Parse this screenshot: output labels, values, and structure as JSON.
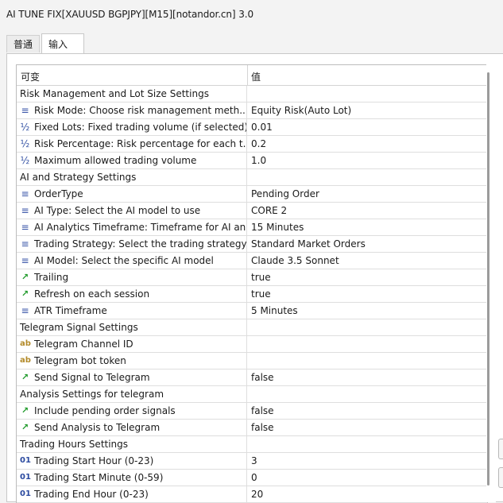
{
  "window": {
    "title": "AI TUNE FIX[XAUUSD BGPJPY][M15][notandor.cn] 3.0"
  },
  "tabs": [
    {
      "label": "普通",
      "active": false
    },
    {
      "label": "输入",
      "active": true
    }
  ],
  "grid": {
    "headers": {
      "variable": "可变",
      "value": "值"
    },
    "rows": [
      {
        "type": "group",
        "name": "Risk Management and Lot Size Settings",
        "value": ""
      },
      {
        "type": "enum",
        "icon": "≡",
        "name": "Risk Mode: Choose risk management meth...",
        "value": "Equity Risk(Auto Lot)"
      },
      {
        "type": "dbl",
        "icon": "½",
        "name": "Fixed Lots: Fixed trading volume (if selected)",
        "value": "0.01"
      },
      {
        "type": "dbl",
        "icon": "½",
        "name": "Risk Percentage: Risk percentage for each t...",
        "value": "0.2"
      },
      {
        "type": "dbl",
        "icon": "½",
        "name": "Maximum allowed trading volume",
        "value": "1.0"
      },
      {
        "type": "group",
        "name": "AI and Strategy Settings",
        "value": ""
      },
      {
        "type": "enum",
        "icon": "≡",
        "name": "OrderType",
        "value": "Pending Order"
      },
      {
        "type": "enum",
        "icon": "≡",
        "name": "AI Type: Select the AI model to use",
        "value": "CORE 2"
      },
      {
        "type": "enum",
        "icon": "≡",
        "name": "AI Analytics Timeframe: Timeframe for AI an...",
        "value": "15 Minutes"
      },
      {
        "type": "enum",
        "icon": "≡",
        "name": "Trading Strategy: Select the trading strategy...",
        "value": "Standard Market Orders"
      },
      {
        "type": "enum",
        "icon": "≡",
        "name": "AI Model: Select the specific AI model",
        "value": "Claude 3.5 Sonnet"
      },
      {
        "type": "bool",
        "icon": "↗",
        "name": "Trailing",
        "value": "true"
      },
      {
        "type": "bool",
        "icon": "↗",
        "name": "Refresh on each session",
        "value": "true"
      },
      {
        "type": "enum",
        "icon": "≡",
        "name": "ATR Timeframe",
        "value": "5 Minutes"
      },
      {
        "type": "group",
        "name": "Telegram Signal Settings",
        "value": ""
      },
      {
        "type": "str",
        "icon": "ab",
        "name": "Telegram Channel ID",
        "value": ""
      },
      {
        "type": "str",
        "icon": "ab",
        "name": "Telegram bot token",
        "value": ""
      },
      {
        "type": "bool",
        "icon": "↗",
        "name": "Send Signal to Telegram",
        "value": "false"
      },
      {
        "type": "group",
        "name": "Analysis Settings for telegram",
        "value": ""
      },
      {
        "type": "bool",
        "icon": "↗",
        "name": "Include pending order signals",
        "value": "false"
      },
      {
        "type": "bool",
        "icon": "↗",
        "name": "Send Analysis to Telegram",
        "value": "false"
      },
      {
        "type": "group",
        "name": "Trading Hours Settings",
        "value": ""
      },
      {
        "type": "int",
        "icon": "01",
        "name": "Trading Start Hour (0-23)",
        "value": "3"
      },
      {
        "type": "int",
        "icon": "01",
        "name": "Trading Start Minute (0-59)",
        "value": "0"
      },
      {
        "type": "int",
        "icon": "01",
        "name": "Trading End Hour (0-23)",
        "value": "20"
      }
    ]
  }
}
